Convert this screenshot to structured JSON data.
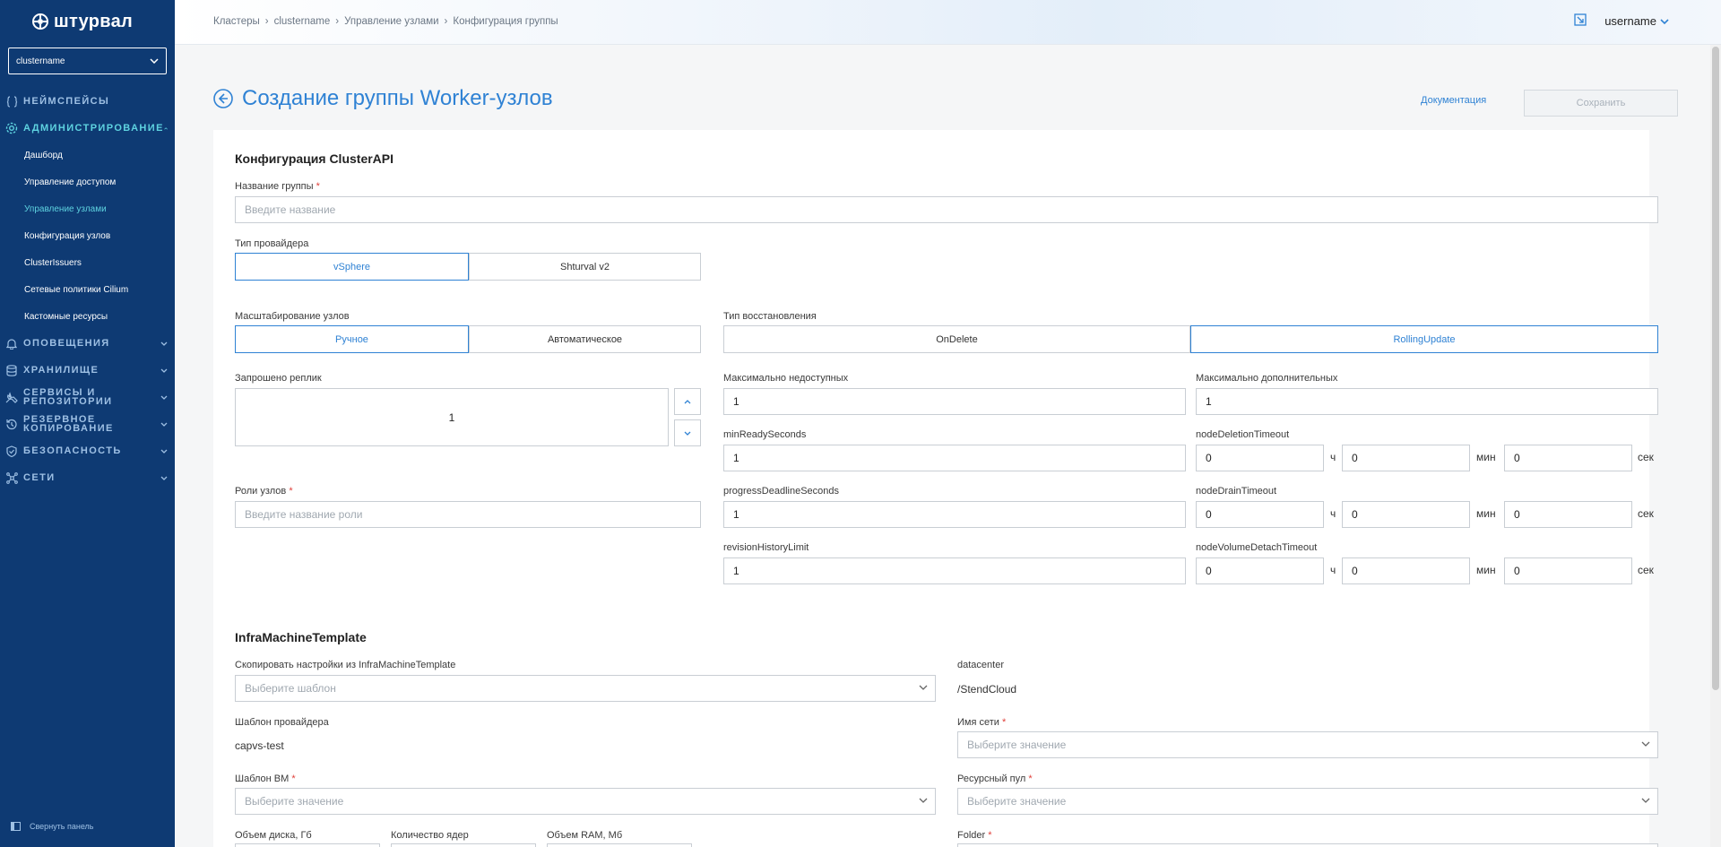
{
  "app": {
    "logo_text": "штурвал",
    "cluster_select": "clustername",
    "collapse_label": "Свернуть панель",
    "user": "username"
  },
  "nav": {
    "sections": [
      {
        "label": "НЕЙМСПЕЙСЫ",
        "icon": "namespace-icon"
      },
      {
        "label": "АДМИНИСТРИРОВАНИЕ",
        "icon": "gear-icon"
      },
      {
        "label": "ОПОВЕЩЕНИЯ",
        "icon": "bell-icon"
      },
      {
        "label": "ХРАНИЛИЩЕ",
        "icon": "database-icon"
      },
      {
        "label": "СЕРВИСЫ И РЕПОЗИТОРИИ",
        "icon": "tools-icon"
      },
      {
        "label": "РЕЗЕРВНОЕ КОПИРОВАНИЕ",
        "icon": "backup-icon"
      },
      {
        "label": "БЕЗОПАСНОСТЬ",
        "icon": "shield-icon"
      },
      {
        "label": "СЕТИ",
        "icon": "network-icon"
      }
    ],
    "admin_items": [
      "Дашборд",
      "Управление доступом",
      "Управление узлами",
      "Конфигурация узлов",
      "ClusterIssuers",
      "Сетевые политики Cilium",
      "Кастомные ресурсы"
    ]
  },
  "breadcrumbs": [
    "Кластеры",
    "clustername",
    "Управление узлами",
    "Конфигурация группы"
  ],
  "page": {
    "title": "Создание группы Worker-узлов",
    "doc_link": "Документация",
    "save": "Сохранить"
  },
  "clusterapi": {
    "heading": "Конфигурация ClusterAPI",
    "group_name_label": "Название группы",
    "group_name_placeholder": "Введите название",
    "provider_label": "Тип провайдера",
    "providers": [
      "vSphere",
      "Shturval v2"
    ],
    "scaling_label": "Масштабирование узлов",
    "scaling": [
      "Ручное",
      "Автоматическое"
    ],
    "recovery_label": "Тип восстановления",
    "recovery": [
      "OnDelete",
      "RollingUpdate"
    ],
    "replicas_label": "Запрошено реплик",
    "replicas_value": "1",
    "roles_label": "Роли узлов",
    "roles_placeholder": "Введите название роли",
    "max_unavailable_label": "Максимально недоступных",
    "max_unavailable": "1",
    "max_surge_label": "Максимально дополнительных",
    "max_surge": "1",
    "min_ready_label": "minReadySeconds",
    "min_ready": "1",
    "progress_label": "progressDeadlineSeconds",
    "progress": "1",
    "revision_label": "revisionHistoryLimit",
    "revision": "1",
    "node_deletion_label": "nodeDeletionTimeout",
    "node_drain_label": "nodeDrainTimeout",
    "node_volume_label": "nodeVolumeDetachTimeout",
    "time_values": [
      "0",
      "0",
      "0"
    ],
    "units": [
      "ч",
      "мин",
      "сек"
    ]
  },
  "infra": {
    "heading": "InfraMachineTemplate",
    "copy_label": "Скопировать настройки из InfraMachineTemplate",
    "copy_placeholder": "Выберите шаблон",
    "datacenter_label": "datacenter",
    "datacenter_value": "/StendCloud",
    "provider_template_label": "Шаблон провайдера",
    "provider_template_value": "capvs-test",
    "network_label": "Имя сети",
    "network_placeholder": "Выберите значение",
    "vm_template_label": "Шаблон ВМ",
    "vm_template_placeholder": "Выберите значение",
    "resource_pool_label": "Ресурсный пул",
    "resource_pool_placeholder": "Выберите значение",
    "disk_label": "Объем диска, Гб",
    "cores_label": "Количество ядер",
    "ram_label": "Объем RAM, Мб",
    "folder_label": "Folder"
  },
  "colors": {
    "sidebar": "#0e3a73",
    "accent": "#2f82d4",
    "active_nav": "#5ed3e0",
    "required": "#e0403a"
  }
}
